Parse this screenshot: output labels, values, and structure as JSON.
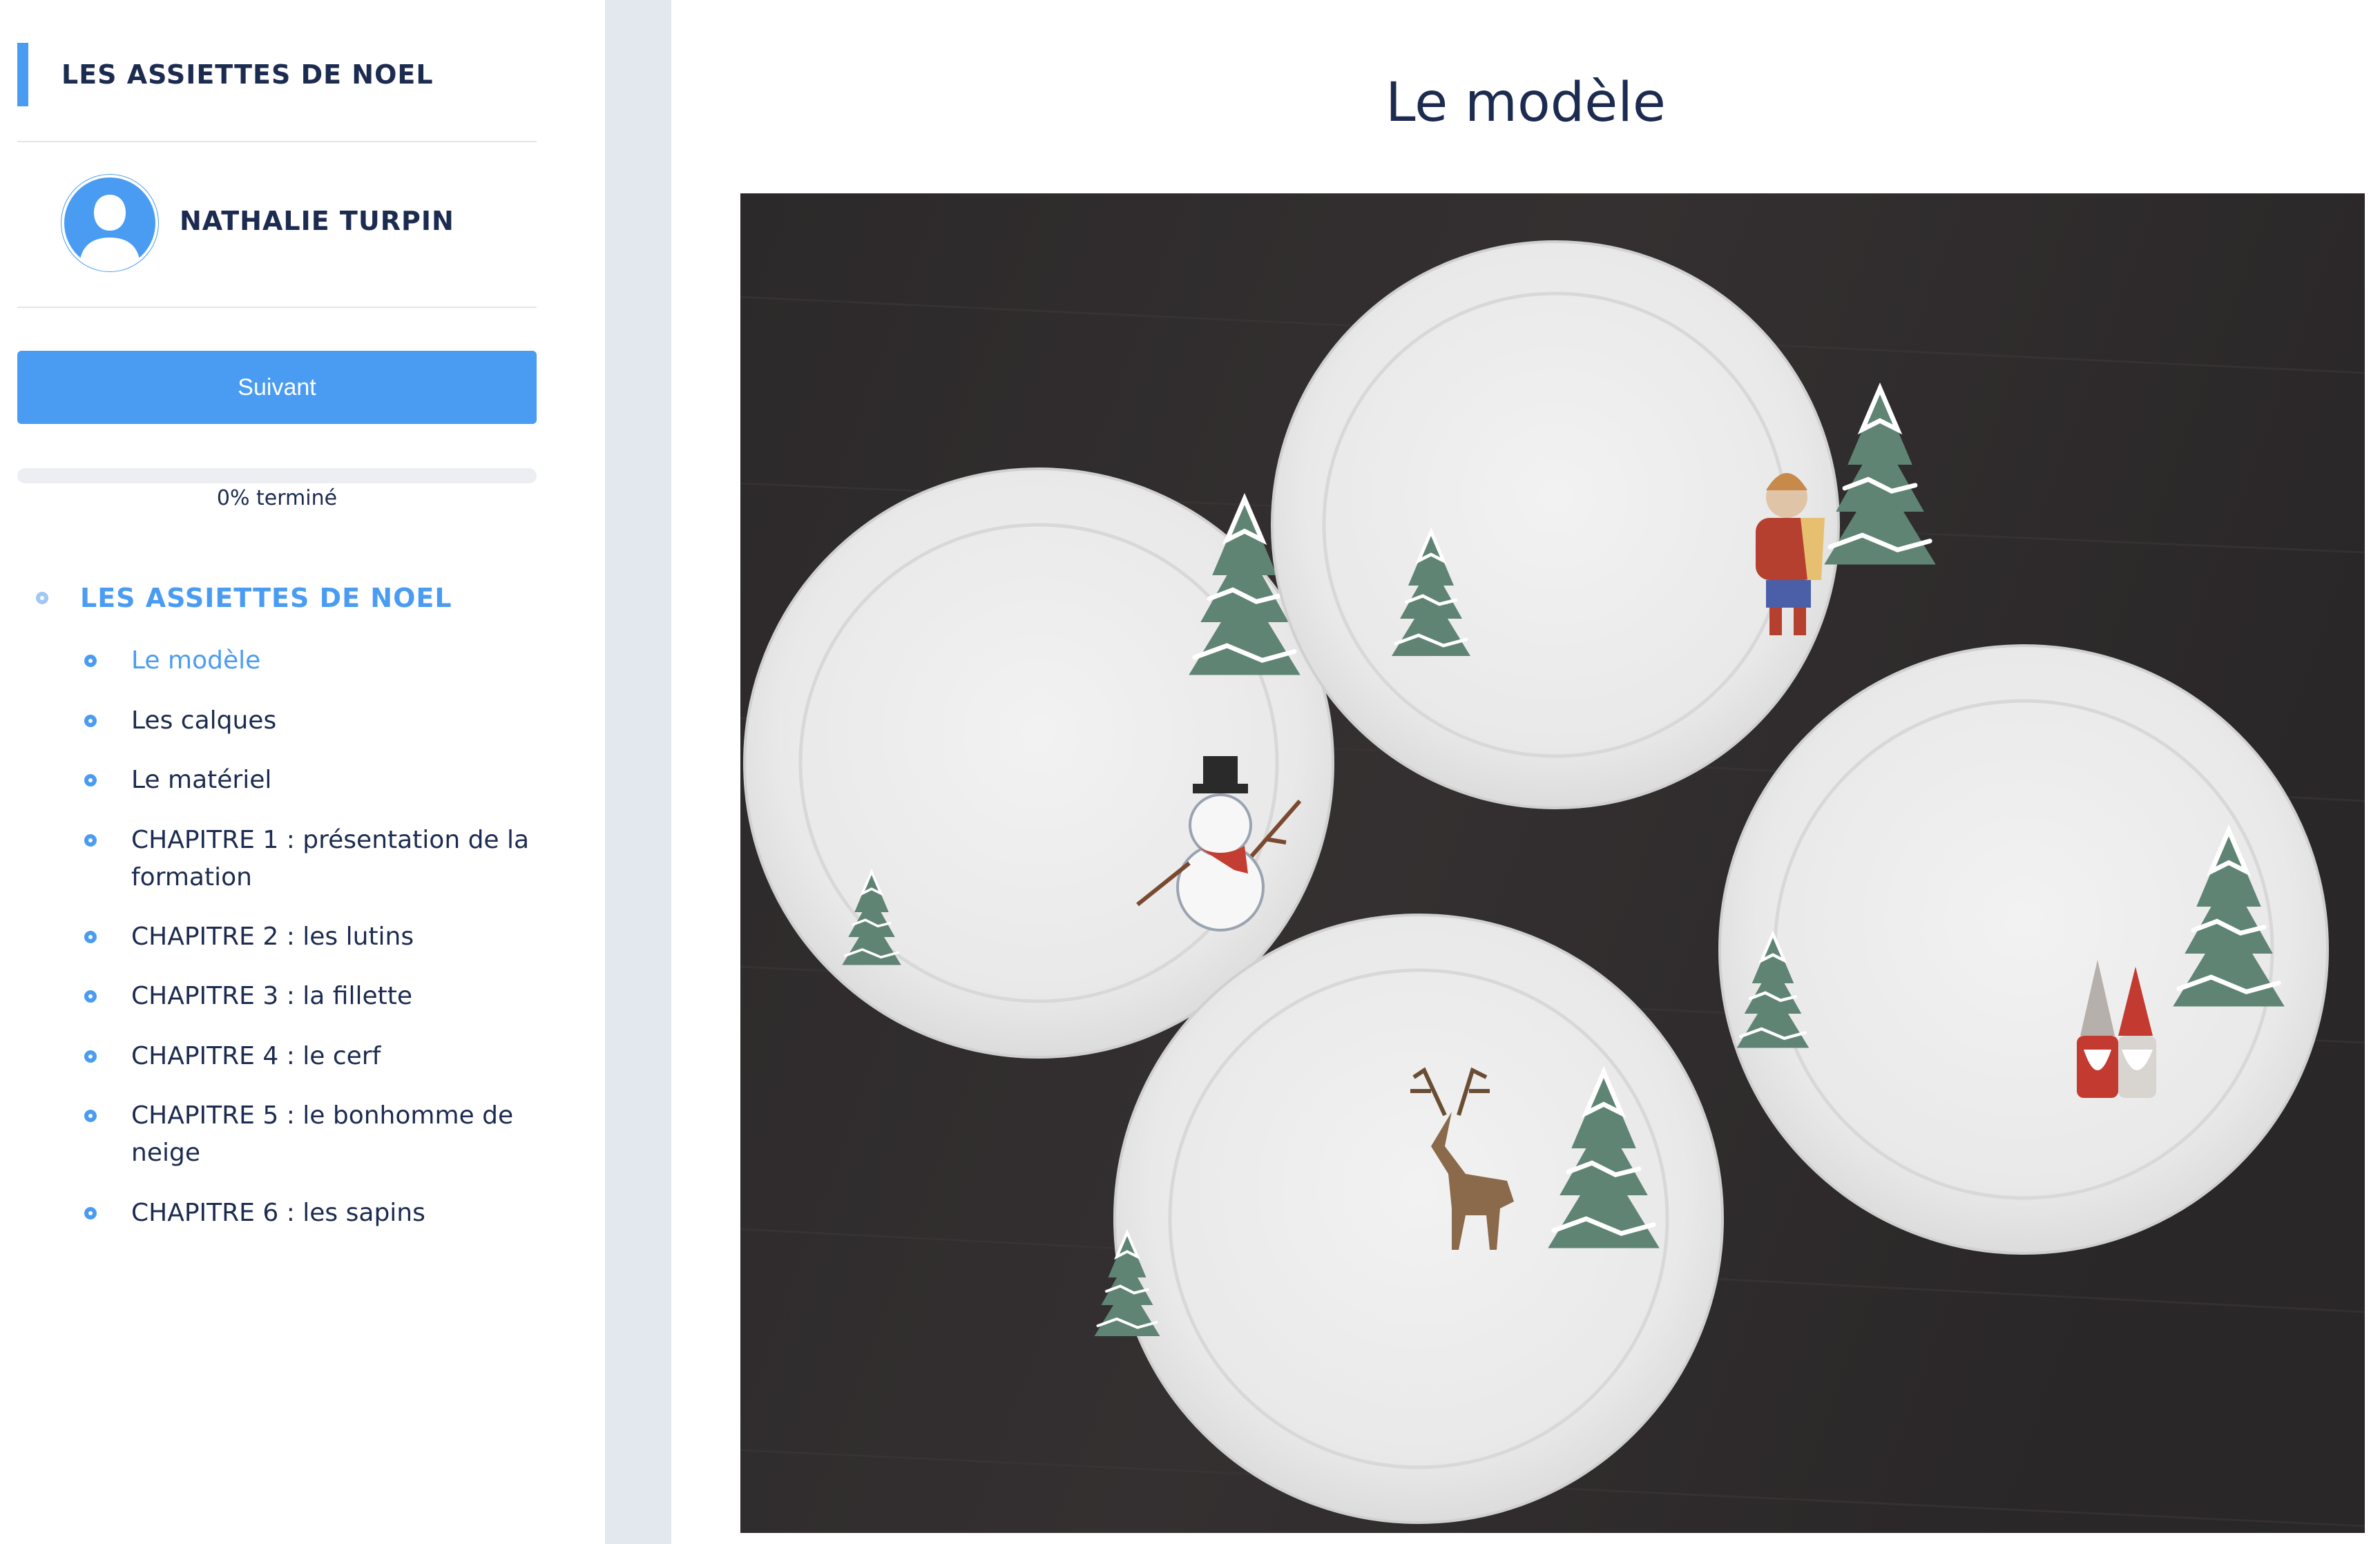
{
  "course": {
    "title": "LES ASSIETTES DE NOEL"
  },
  "user": {
    "name": "NATHALIE TURPIN",
    "avatar_icon": "user-avatar-icon"
  },
  "next_button": {
    "label": "Suivant"
  },
  "progress": {
    "percent": 0,
    "label": "0% terminé"
  },
  "curriculum": {
    "section_title": "LES ASSIETTES DE NOEL",
    "lessons": [
      {
        "label": "Le modèle",
        "active": true
      },
      {
        "label": "Les calques",
        "active": false
      },
      {
        "label": "Le matériel",
        "active": false
      },
      {
        "label": "CHAPITRE 1 : présentation de la formation",
        "active": false
      },
      {
        "label": "CHAPITRE 2 : les lutins",
        "active": false
      },
      {
        "label": "CHAPITRE 3 : la fillette",
        "active": false
      },
      {
        "label": "CHAPITRE 4 : le cerf",
        "active": false
      },
      {
        "label": "CHAPITRE 5 : le bonhomme de neige",
        "active": false
      },
      {
        "label": "CHAPITRE 6 : les sapins",
        "active": false
      }
    ]
  },
  "main": {
    "title": "Le modèle"
  },
  "colors": {
    "accent": "#4a9cf2",
    "text": "#1c2b50",
    "gutter": "#e3e7ee",
    "table": "#2f2c2d"
  }
}
